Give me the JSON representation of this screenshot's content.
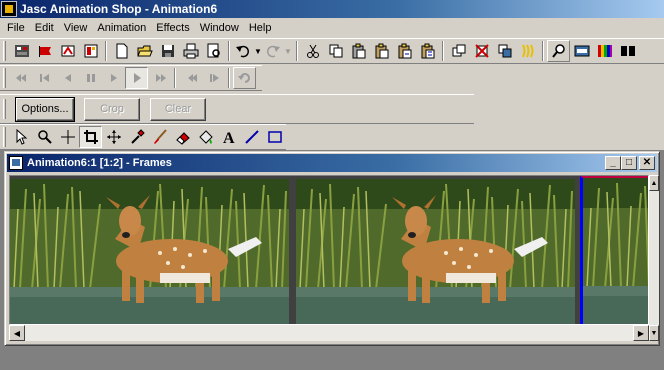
{
  "app": {
    "title": "Jasc Animation Shop - Animation6"
  },
  "menu": [
    "File",
    "Edit",
    "View",
    "Animation",
    "Effects",
    "Window",
    "Help"
  ],
  "toolbar_standard": {
    "icons": [
      "wizard-icon",
      "banner-wizard-icon",
      "animation-wizard-icon",
      "properties-icon",
      "new-icon",
      "open-icon",
      "save-icon",
      "print-icon",
      "print-preview-icon",
      "undo-icon",
      "redo-icon",
      "cut-icon",
      "copy-icon",
      "paste-as-new-icon",
      "paste-icon",
      "paste-before-icon",
      "paste-after-icon",
      "insert-frames-icon",
      "delete-frames-icon",
      "frame-properties-icon",
      "optimization-icon",
      "zoom-icon",
      "view-animation-icon",
      "color-palette-icon"
    ]
  },
  "toolbar_playback": {
    "icons": [
      "first-frame-icon",
      "previous-frame-icon",
      "step-back-icon",
      "pause-icon",
      "step-forward-icon",
      "play-icon",
      "next-frame-icon",
      "move-left-icon",
      "move-right-icon",
      "replay-icon"
    ]
  },
  "tool_options": {
    "options_label": "Options...",
    "crop_label": "Crop",
    "clear_label": "Clear"
  },
  "tools": [
    "arrow-icon",
    "zoom-tool-icon",
    "crosshair-icon",
    "crop-tool-icon",
    "mover-icon",
    "dropper-icon",
    "paint-brush-icon",
    "eraser-icon",
    "flood-fill-icon",
    "text-tool-icon",
    "line-tool-icon",
    "rectangle-tool-icon"
  ],
  "child_window": {
    "title": "Animation6:1 [1:2] - Frames",
    "buttons": {
      "minimize": "_",
      "maximize": "□",
      "close": "✕"
    }
  },
  "frames": [
    {
      "label": "frame-1",
      "selected": false
    },
    {
      "label": "frame-2",
      "selected": false
    },
    {
      "label": "frame-3",
      "selected": true
    }
  ],
  "colors": {
    "title_start": "#0a246a",
    "title_end": "#a6caf0",
    "selection": "#0000ff"
  }
}
